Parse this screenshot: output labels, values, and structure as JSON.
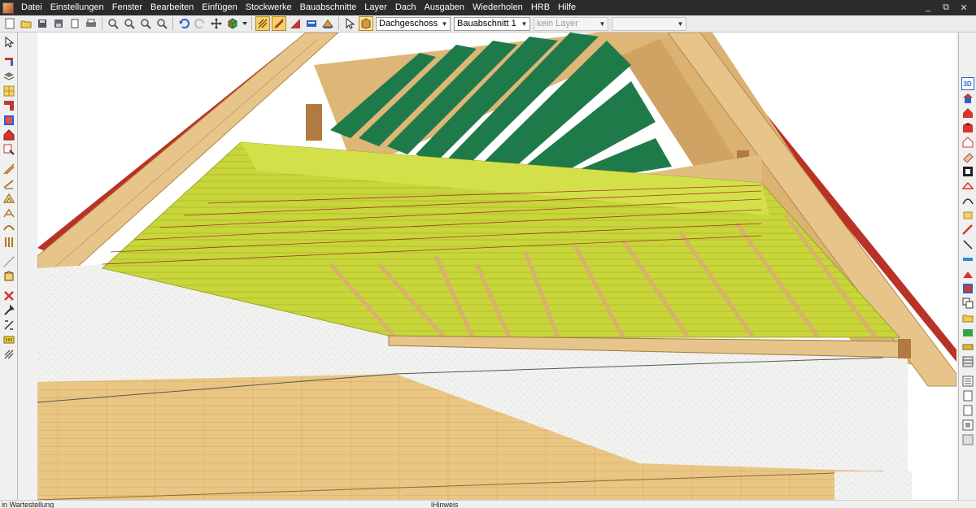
{
  "menu": {
    "items": [
      "Datei",
      "Einstellungen",
      "Fenster",
      "Bearbeiten",
      "Einfügen",
      "Stockwerke",
      "Bauabschnitte",
      "Layer",
      "Dach",
      "Ausgaben",
      "Wiederholen",
      "HRB",
      "Hilfe"
    ],
    "window_controls": [
      "_",
      "⧉",
      "✕"
    ]
  },
  "toolbar": {
    "floor_select": "Dachgeschoss",
    "section_select": "Bauabschnitt 1",
    "layer_select": "kein Layer",
    "extra_select": ""
  },
  "viewport": {
    "right_toolbar_label": "3D"
  },
  "status": {
    "left": "in Wartestellung",
    "middle": "iHinweis"
  },
  "colors": {
    "menubar": "#2b2b2b",
    "insulation": "#c8d63a",
    "timber": "#e6c48a",
    "roof_green": "#1f7a4a",
    "roof_tile": "#b83226",
    "wall": "#efefef"
  }
}
